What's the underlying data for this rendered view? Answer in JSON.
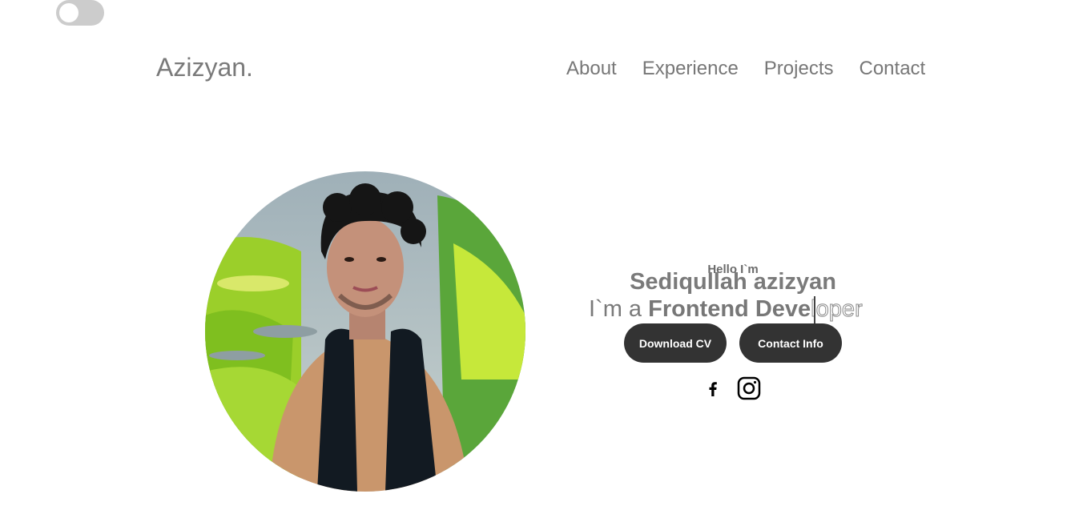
{
  "theme_toggle": {
    "state": "off"
  },
  "header": {
    "logo": "Azizyan.",
    "nav": [
      {
        "label": "About"
      },
      {
        "label": "Experience"
      },
      {
        "label": "Projects"
      },
      {
        "label": "Contact"
      }
    ]
  },
  "hero": {
    "greeting": "Hello I`m",
    "name": "Sediqullah azizyan",
    "role_prefix": "I`m a ",
    "role_typed": "Frontend Deve",
    "role_remaining": "loper",
    "buttons": {
      "download_cv": "Download CV",
      "contact_info": "Contact Info"
    },
    "social": [
      {
        "icon": "facebook-icon"
      },
      {
        "icon": "instagram-icon"
      }
    ]
  },
  "colors": {
    "button_bg": "#333333",
    "text_gray": "#7a7a7a",
    "toggle_bg": "#cccccc"
  }
}
